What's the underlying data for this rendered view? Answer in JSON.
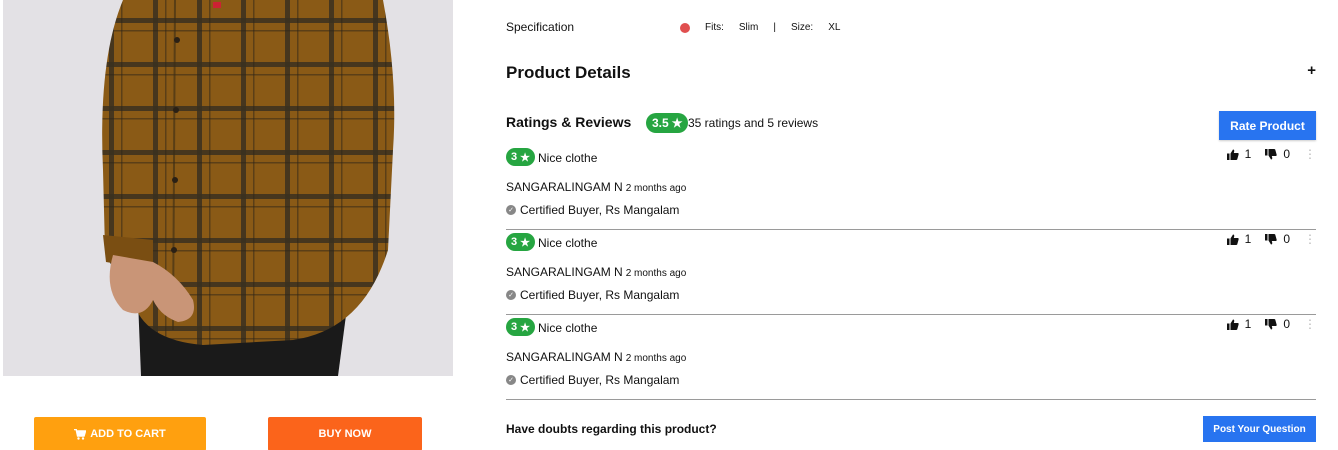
{
  "product": {
    "image_alt": "Brown checked shirt product photo"
  },
  "actions": {
    "add_to_cart_label": "ADD TO CART",
    "buy_now_label": "BUY NOW",
    "cart_icon": "cart-icon"
  },
  "specification": {
    "label": "Specification",
    "color_hex": "#e04f4f",
    "fits_label": "Fits:",
    "fits_value": "Slim",
    "separator": "|",
    "size_label": "Size:",
    "size_value": "XL"
  },
  "product_details": {
    "title": "Product Details",
    "expand_symbol": "+"
  },
  "ratings": {
    "title": "Ratings & Reviews",
    "overall": "3.5",
    "star": "★",
    "summary": "35 ratings and 5 reviews",
    "rate_button": "Rate Product",
    "badge_color": "#26a541"
  },
  "reviews": [
    {
      "rating": "3",
      "title": "Nice clothe",
      "author": "SANGARALINGAM N",
      "time": "2 months ago",
      "certified": "Certified Buyer, Rs Mangalam",
      "likes": "1",
      "dislikes": "0"
    },
    {
      "rating": "3",
      "title": "Nice clothe",
      "author": "SANGARALINGAM N",
      "time": "2 months ago",
      "certified": "Certified Buyer, Rs Mangalam",
      "likes": "1",
      "dislikes": "0"
    },
    {
      "rating": "3",
      "title": "Nice clothe",
      "author": "SANGARALINGAM N",
      "time": "2 months ago",
      "certified": "Certified Buyer, Rs Mangalam",
      "likes": "1",
      "dislikes": "0"
    }
  ],
  "questions": {
    "prompt": "Have doubts regarding this product?",
    "post_button": "Post Your Question"
  },
  "colors": {
    "add_to_cart": "#ffa00f",
    "buy_now": "#fb641b",
    "primary_blue": "#2874f0"
  }
}
